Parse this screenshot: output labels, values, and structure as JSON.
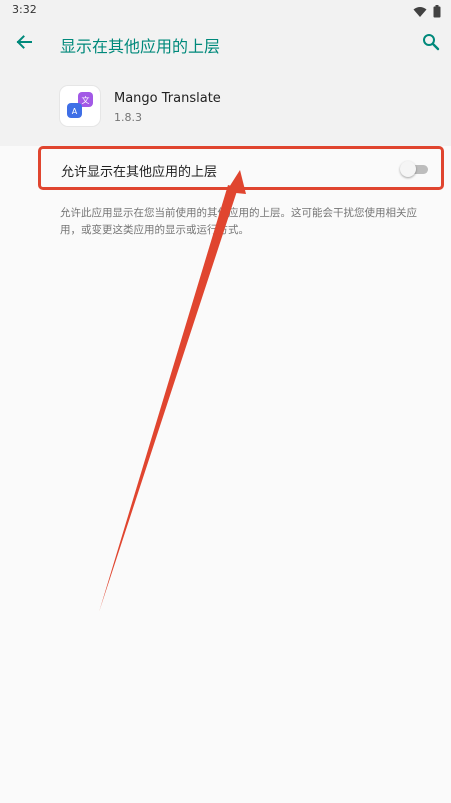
{
  "status_bar": {
    "time": "3:32",
    "icons": [
      "wifi-icon",
      "battery-icon"
    ]
  },
  "app_bar": {
    "title": "显示在其他应用的上层",
    "back_icon": "arrow-left-icon",
    "search_icon": "search-icon"
  },
  "app_info": {
    "name": "Mango Translate",
    "version": "1.8.3",
    "icon_glyphs": [
      "文",
      "A"
    ]
  },
  "setting": {
    "label": "允许显示在其他应用的上层",
    "enabled": false
  },
  "description": "允许此应用显示在您当前使用的其他应用的上层。这可能会干扰您使用相关应用，或变更这类应用的显示或运行方式。",
  "colors": {
    "accent": "#00897b",
    "highlight": "#e0452f"
  }
}
